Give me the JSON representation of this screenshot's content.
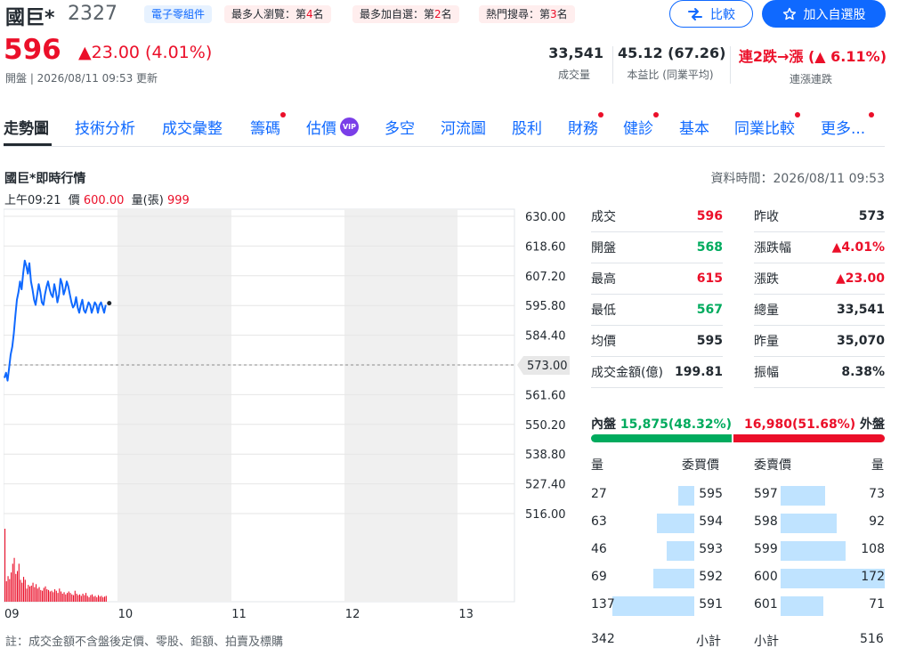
{
  "header": {
    "name": "國巨*",
    "code": "2327",
    "category_tag": "電子零組件",
    "rank_tags": [
      {
        "prefix": "最多人瀏覽：第",
        "rank": "4",
        "suffix": "名"
      },
      {
        "prefix": "最多加自選：第",
        "rank": "2",
        "suffix": "名"
      },
      {
        "prefix": "熱門搜尋：第",
        "rank": "3",
        "suffix": "名"
      }
    ],
    "compare_label": "比較",
    "watchlist_label": "加入自選股",
    "price": "596",
    "change": "23.00 (4.01%)",
    "session_text": "開盤 | 2026/08/11 09:53 更新",
    "key_stats": [
      {
        "value": "33,541",
        "label": "成交量"
      },
      {
        "value": "45.12 (67.26)",
        "label": "本益比 (同業平均)"
      },
      {
        "value": "連2跌→漲",
        "value2": "6.11%",
        "label": "連漲連跌"
      }
    ]
  },
  "tabs": [
    {
      "label": "走勢圖",
      "active": true,
      "dot": false
    },
    {
      "label": "技術分析",
      "dot": false
    },
    {
      "label": "成交彙整",
      "dot": false
    },
    {
      "label": "籌碼",
      "dot": true
    },
    {
      "label": "估價",
      "vip": "VIP",
      "dot": false
    },
    {
      "label": "多空",
      "dot": false
    },
    {
      "label": "河流圖",
      "dot": false
    },
    {
      "label": "股利",
      "dot": false
    },
    {
      "label": "財務",
      "dot": true
    },
    {
      "label": "健診",
      "dot": true
    },
    {
      "label": "基本",
      "dot": false
    },
    {
      "label": "同業比較",
      "dot": true
    },
    {
      "label": "更多...",
      "dot": true
    }
  ],
  "realtime": {
    "title": "國巨*即時行情",
    "data_time": "資料時間：2026/08/11 09:53",
    "hover_time": "上午09:21",
    "hover_price_label": "價",
    "hover_price": "600.00",
    "hover_vol_label": "量(張)",
    "hover_vol": "999"
  },
  "chart_data": {
    "type": "line",
    "x_ticks": [
      "09",
      "10",
      "11",
      "12",
      "13"
    ],
    "y_ticks": [
      "630.00",
      "618.60",
      "607.20",
      "595.80",
      "584.40",
      "573.00",
      "561.60",
      "550.20",
      "538.80",
      "527.40",
      "516.00"
    ],
    "reference_price": "573.00",
    "ylim": [
      516,
      630
    ],
    "series": [
      {
        "values": [
          568,
          570,
          567,
          572,
          577,
          580,
          585,
          592,
          598,
          601,
          605,
          602,
          608,
          613,
          611,
          608,
          612,
          605,
          602,
          598,
          596,
          600,
          604,
          601,
          597,
          596,
          600,
          603,
          605,
          602,
          600,
          599,
          604,
          601,
          597,
          600,
          606,
          604,
          600,
          602,
          605,
          603,
          600,
          597,
          595,
          596,
          599,
          595,
          593,
          596,
          598,
          594,
          593,
          595,
          597,
          596,
          593,
          595,
          597,
          596,
          593,
          596,
          597,
          595,
          593,
          596
        ]
      }
    ],
    "volume": [
      999,
      280,
      350,
      310,
      400,
      520,
      600,
      380,
      420,
      520,
      300,
      260,
      340,
      300,
      180,
      230,
      210,
      220,
      260,
      200,
      240,
      180,
      200,
      160,
      150,
      190,
      210,
      170,
      160,
      140,
      150,
      130,
      170,
      150,
      120,
      180,
      140,
      110,
      130,
      100,
      120,
      140,
      120,
      100,
      90,
      150,
      110,
      90,
      100,
      80,
      110,
      90,
      120,
      80,
      60,
      90,
      100,
      70,
      80,
      60,
      90,
      70,
      80,
      60,
      70,
      80
    ],
    "volume_max": 999
  },
  "quote": {
    "left": [
      {
        "label": "成交",
        "value": "596",
        "tone": "up"
      },
      {
        "label": "開盤",
        "value": "568",
        "tone": "down"
      },
      {
        "label": "最高",
        "value": "615",
        "tone": "up"
      },
      {
        "label": "最低",
        "value": "567",
        "tone": "down"
      },
      {
        "label": "均價",
        "value": "595",
        "tone": ""
      },
      {
        "label": "成交金額(億)",
        "value": "199.81",
        "tone": ""
      }
    ],
    "right": [
      {
        "label": "昨收",
        "value": "573",
        "tone": ""
      },
      {
        "label": "漲跌幅",
        "value": "▲4.01%",
        "tone": "up"
      },
      {
        "label": "漲跌",
        "value": "▲23.00",
        "tone": "up"
      },
      {
        "label": "總量",
        "value": "33,541",
        "tone": ""
      },
      {
        "label": "昨量",
        "value": "35,070",
        "tone": ""
      },
      {
        "label": "振幅",
        "value": "8.38%",
        "tone": ""
      }
    ]
  },
  "inout": {
    "inner_label": "內盤",
    "inner_value": "15,875(48.32%)",
    "inner_pct": 48.32,
    "outer_value": "16,980(51.68%)",
    "outer_label": "外盤"
  },
  "orderbook": {
    "bid_qty_label": "量",
    "bid_price_label": "委買價",
    "ask_price_label": "委賣價",
    "ask_qty_label": "量",
    "bids": [
      {
        "qty": "27",
        "price": "595",
        "qty_num": 27
      },
      {
        "qty": "63",
        "price": "594",
        "qty_num": 63
      },
      {
        "qty": "46",
        "price": "593",
        "qty_num": 46
      },
      {
        "qty": "69",
        "price": "592",
        "qty_num": 69
      },
      {
        "qty": "137",
        "price": "591",
        "qty_num": 137
      }
    ],
    "asks": [
      {
        "price": "597",
        "qty": "73",
        "qty_num": 73
      },
      {
        "price": "598",
        "qty": "92",
        "qty_num": 92
      },
      {
        "price": "599",
        "qty": "108",
        "qty_num": 108
      },
      {
        "price": "600",
        "qty": "172",
        "qty_num": 172
      },
      {
        "price": "601",
        "qty": "71",
        "qty_num": 71
      }
    ],
    "bid_total": "342",
    "subtotal_label": "小計",
    "ask_total": "516"
  },
  "footnote": "註：成交金額不含盤後定價、零股、鉅額、拍賣及標購",
  "colors": {
    "up": "#eb0f29",
    "down": "#00ab5e",
    "accent": "#0f69ff",
    "line": "#0f69ff"
  }
}
